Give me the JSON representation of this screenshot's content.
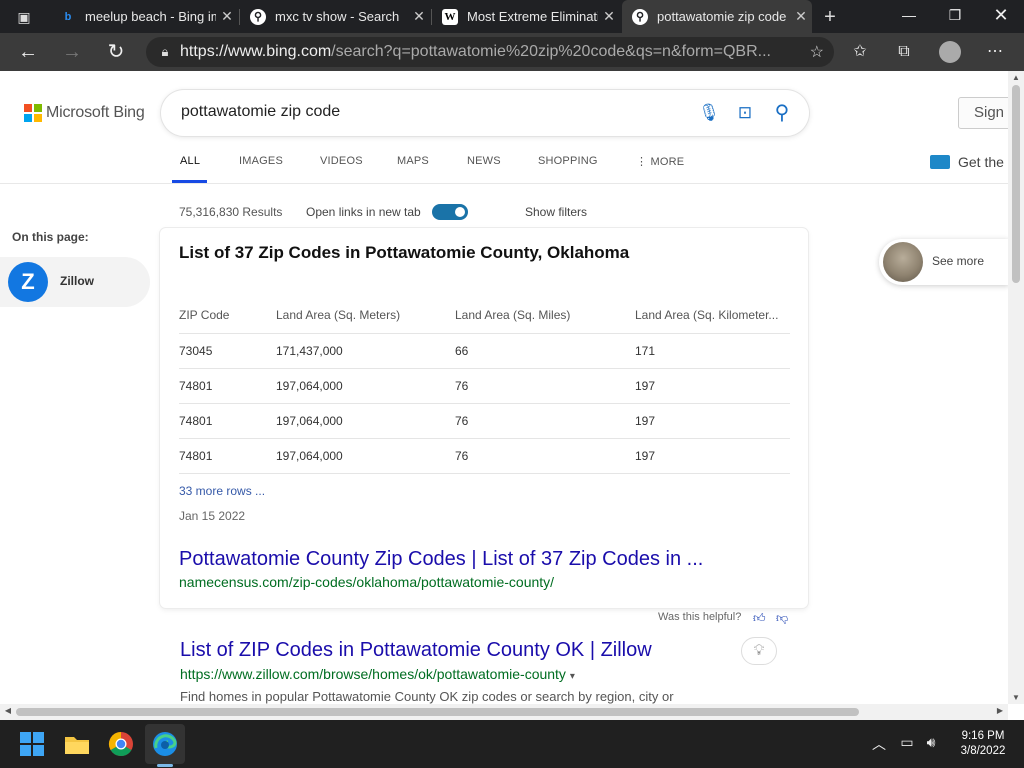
{
  "browser": {
    "tabs": [
      {
        "title": "meelup beach - Bing im",
        "favicon": "bing"
      },
      {
        "title": "mxc tv show - Search",
        "favicon": "search"
      },
      {
        "title": "Most Extreme Eliminatio",
        "favicon": "wikipedia"
      },
      {
        "title": "pottawatomie zip code",
        "favicon": "search",
        "active": true
      }
    ],
    "url_host": "https://www.bing.com",
    "url_path": "/search?q=pottawatomie%20zip%20code&qs=n&form=QBR..."
  },
  "bing": {
    "logo_text": "Microsoft Bing",
    "query": "pottawatomie zip code",
    "signin_label": "Sign in",
    "nav_tabs": [
      "ALL",
      "IMAGES",
      "VIDEOS",
      "MAPS",
      "NEWS",
      "SHOPPING",
      "MORE"
    ],
    "get_the": "Get the",
    "result_count": "75,316,830 Results",
    "open_links_label": "Open links in new tab",
    "open_links_on": true,
    "show_filters": "Show filters",
    "sidebar": {
      "heading": "On this page:",
      "item": "Zillow"
    },
    "see_more": "See more"
  },
  "answer_card": {
    "title": "List of 37 Zip Codes in Pottawatomie County, Oklahoma",
    "headers": [
      "ZIP Code",
      "Land Area (Sq. Meters)",
      "Land Area (Sq. Miles)",
      "Land Area (Sq. Kilometer..."
    ],
    "rows": [
      [
        "73045",
        "171,437,000",
        "66",
        "171"
      ],
      [
        "74801",
        "197,064,000",
        "76",
        "197"
      ],
      [
        "74801",
        "197,064,000",
        "76",
        "197"
      ],
      [
        "74801",
        "197,064,000",
        "76",
        "197"
      ]
    ],
    "more_rows": "33 more rows ...",
    "date": "Jan 15 2022",
    "link_title": "Pottawatomie County Zip Codes | List of 37 Zip Codes in ...",
    "link_url": "namecensus.com/zip-codes/oklahoma/pottawatomie-county/",
    "helpful": "Was this helpful?"
  },
  "result2": {
    "title": "List of ZIP Codes in Pottawatomie County OK | Zillow",
    "url": "https://www.zillow.com/browse/homes/ok/pottawatomie-county",
    "desc": "Find homes in popular Pottawatomie County OK zip codes or search by region, city or"
  },
  "taskbar": {
    "time": "9:16 PM",
    "date": "3/8/2022"
  },
  "colors": {
    "accent": "#174ae4",
    "link": "#1a0dab",
    "url_green": "#006d21",
    "toggle": "#1a73a8"
  }
}
